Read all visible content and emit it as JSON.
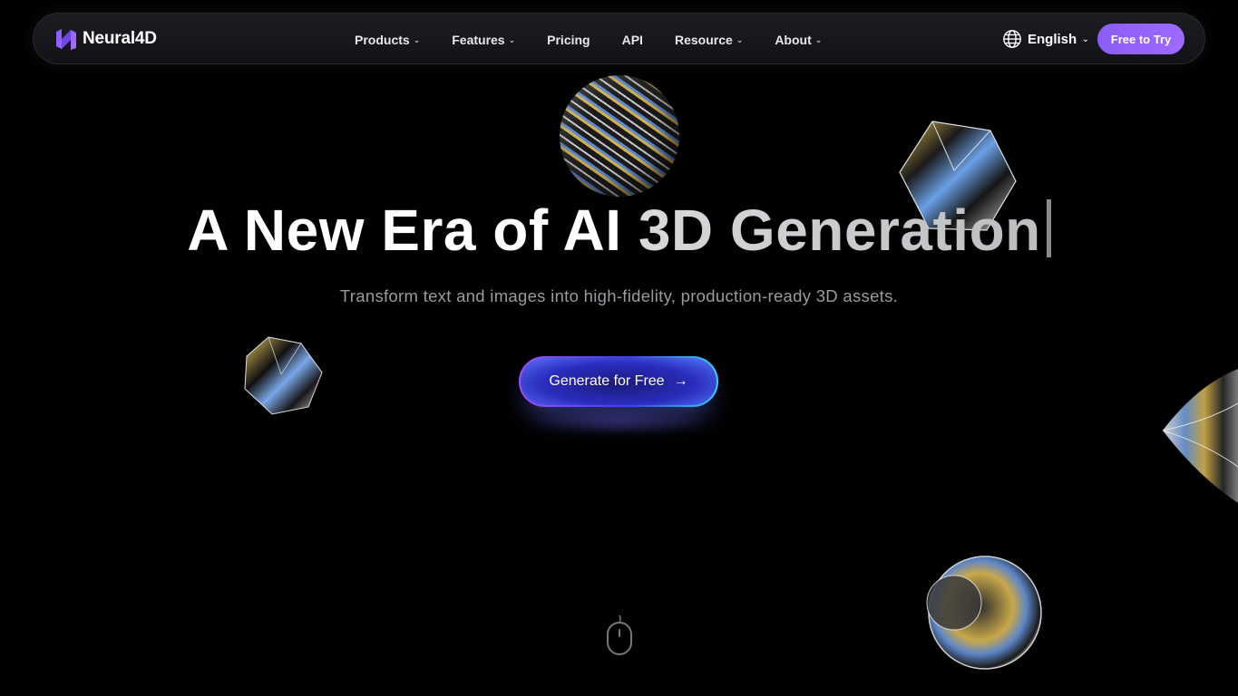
{
  "brand": {
    "name": "Neural4D"
  },
  "nav": {
    "items": [
      {
        "label": "Products",
        "has_dropdown": true
      },
      {
        "label": "Features",
        "has_dropdown": true
      },
      {
        "label": "Pricing",
        "has_dropdown": false
      },
      {
        "label": "API",
        "has_dropdown": false
      },
      {
        "label": "Resource",
        "has_dropdown": true
      },
      {
        "label": "About",
        "has_dropdown": true
      }
    ],
    "language": "English",
    "cta_label": "Free to Try"
  },
  "hero": {
    "title_bright": "A New Era of AI ",
    "title_fade": "3D Generation",
    "subtitle": "Transform text and images into high-fidelity, production-ready 3D assets.",
    "cta_label": "Generate for Free",
    "cta_arrow": "→"
  },
  "icons": {
    "chevron": "chevron-down-icon",
    "globe": "globe-icon",
    "scroll": "mouse-scroll-icon"
  },
  "colors": {
    "background": "#000000",
    "accent_purple": "#8b5cf6",
    "subtitle_gray": "#9a9aa0"
  }
}
